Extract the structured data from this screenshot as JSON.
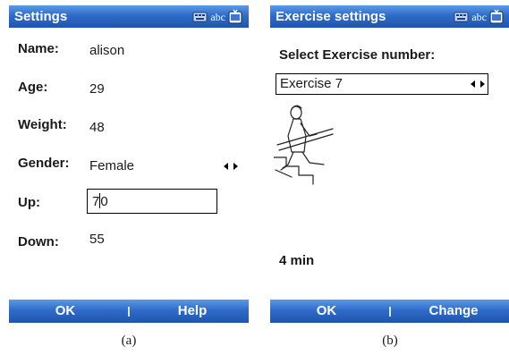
{
  "screen_a": {
    "title": "Settings",
    "input_indicator": "abc",
    "fields": {
      "name": {
        "label": "Name:",
        "value": "alison"
      },
      "age": {
        "label": "Age:",
        "value": "29"
      },
      "weight": {
        "label": "Weight:",
        "value": "48"
      },
      "gender": {
        "label": "Gender:",
        "value": "Female"
      },
      "up": {
        "label": "Up:",
        "value_before_caret": "7",
        "value_after_caret": "0"
      },
      "down": {
        "label": "Down:",
        "value": "55"
      }
    },
    "softkeys": {
      "left": "OK",
      "right": "Help"
    },
    "caption": "(a)"
  },
  "screen_b": {
    "title": "Exercise settings",
    "input_indicator": "abc",
    "select_label": "Select Exercise number:",
    "selected_exercise": "Exercise 7",
    "duration": "4 min",
    "softkeys": {
      "left": "OK",
      "right": "Change"
    },
    "caption": "(b)"
  },
  "icons": {
    "keyboard": "keyboard-icon",
    "input_mode": "input-mode-icon",
    "spin": "left-right-spin-icon"
  },
  "colors": {
    "titlebar": "#2f6cc8",
    "softbar": "#2f6cc8"
  }
}
